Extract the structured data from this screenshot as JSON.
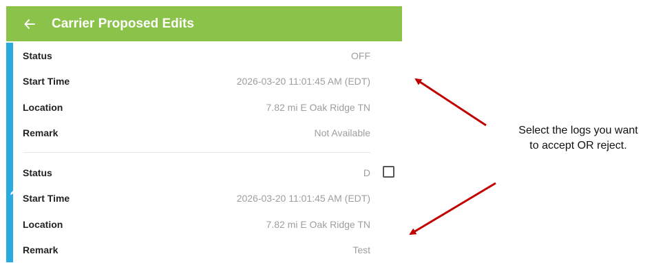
{
  "appbar": {
    "title": "Carrier Proposed Edits",
    "back_icon": "arrow-left-icon",
    "color": "#8bc34a"
  },
  "sidebar": {
    "color": "#29abe2",
    "icon": "pencil-icon"
  },
  "events": [
    {
      "rows": [
        {
          "label": "Status",
          "value": "OFF"
        },
        {
          "label": "Start Time",
          "value": "2026-03-20 11:01:45 AM (EDT)"
        },
        {
          "label": "Location",
          "value": "7.82 mi E Oak Ridge TN"
        },
        {
          "label": "Remark",
          "value": "Not Available"
        }
      ]
    },
    {
      "rows": [
        {
          "label": "Status",
          "value": "D"
        },
        {
          "label": "Start Time",
          "value": "2026-03-20 11:01:45 AM (EDT)"
        },
        {
          "label": "Location",
          "value": "7.82 mi E Oak Ridge TN"
        },
        {
          "label": "Remark",
          "value": "Test"
        }
      ]
    }
  ],
  "annotation": {
    "line1": "Select the logs you want",
    "line2": "to accept OR reject.",
    "arrow_color": "#c00000"
  }
}
